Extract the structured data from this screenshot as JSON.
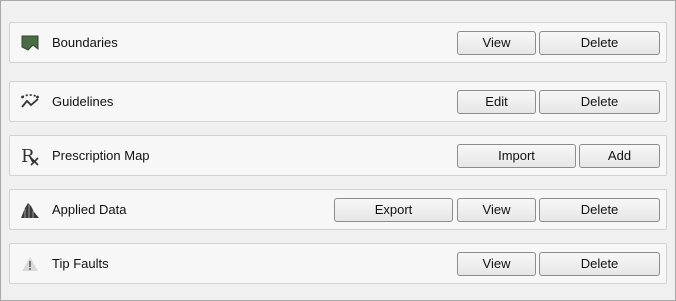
{
  "rows": [
    {
      "label": "Boundaries",
      "icon": "boundary-icon",
      "buttons": [
        "View",
        "Delete"
      ]
    },
    {
      "label": "Guidelines",
      "icon": "guideline-icon",
      "buttons": [
        "Edit",
        "Delete"
      ]
    },
    {
      "label": "Prescription Map",
      "icon": "prescription-icon",
      "buttons": [
        "Import",
        "Add"
      ]
    },
    {
      "label": "Applied Data",
      "icon": "applied-data-icon",
      "buttons": [
        "Export",
        "View",
        "Delete"
      ]
    },
    {
      "label": "Tip Faults",
      "icon": "warning-icon",
      "buttons": [
        "View",
        "Delete"
      ]
    }
  ],
  "colors": {
    "boundary_icon": "#4a6b45",
    "icon_dark": "#333333",
    "warning_icon": "#8a8a8a"
  }
}
